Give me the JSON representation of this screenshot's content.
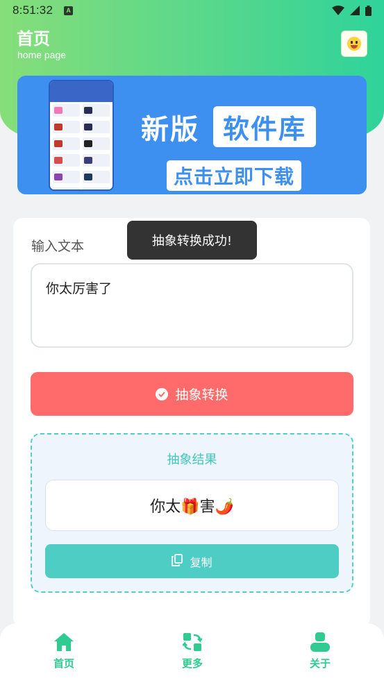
{
  "status_bar": {
    "time": "8:51:32",
    "notification_badge": "A",
    "icons": [
      "wifi-icon",
      "signal-icon",
      "battery-icon"
    ]
  },
  "header": {
    "title": "首页",
    "subtitle": "home page",
    "avatar_icon": "laughing-face-icon"
  },
  "banner": {
    "line1": "新版",
    "highlight": "软件库",
    "cta": "点击立即下载",
    "background_color": "#3d8ff0"
  },
  "form": {
    "input_label": "输入文本",
    "input_value": "你太厉害了",
    "convert_button_label": "抽象转换",
    "toast_message": "抽象转换成功!"
  },
  "result": {
    "title": "抽象结果",
    "value": "你太🎁害🌶️",
    "copy_button_label": "复制"
  },
  "bottom_nav": {
    "items": [
      {
        "label": "首页",
        "icon": "home-icon"
      },
      {
        "label": "更多",
        "icon": "swap-icon"
      },
      {
        "label": "关于",
        "icon": "user-icon"
      }
    ]
  },
  "colors": {
    "accent": "#2fcb91",
    "convert_button": "#fe6b6a",
    "result_accent": "#4ecdc5"
  }
}
